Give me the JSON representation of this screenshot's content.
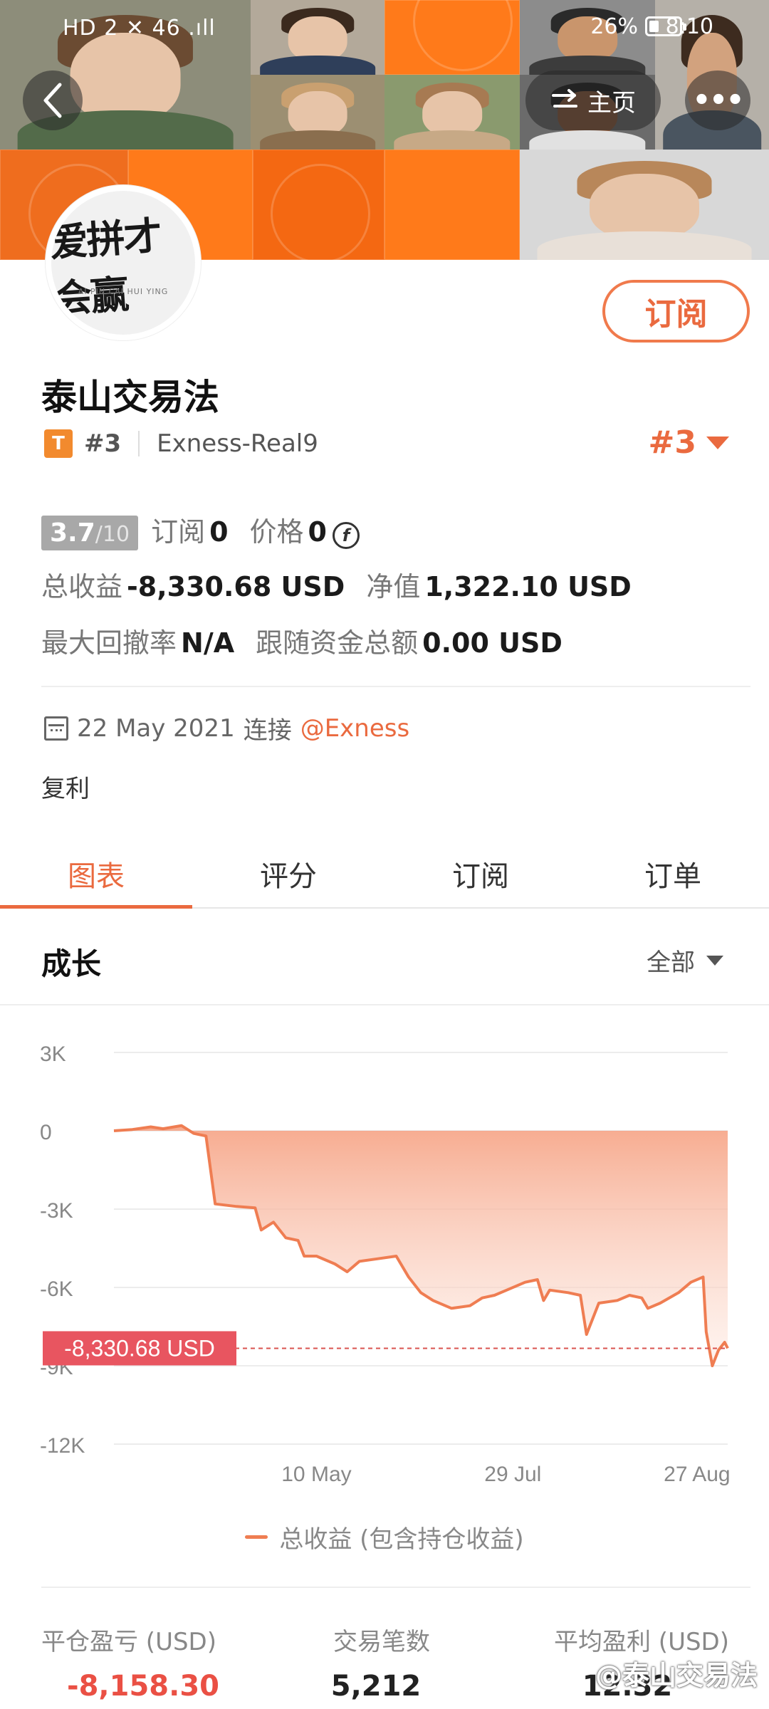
{
  "status_bar": {
    "left": "HD 2 ✕ 46 .ıll",
    "battery": "26%",
    "time": "8:10"
  },
  "header": {
    "home_label": "主页",
    "more_label": "•••"
  },
  "avatar": {
    "logo_text": "爱拼才会赢",
    "logo_sub": "AI PIN CAI HUI YING"
  },
  "subscribe_label": "订阅",
  "profile": {
    "name": "泰山交易法",
    "badge": "T",
    "rank": "#3",
    "broker": "Exness-Real9",
    "rank_right": "#3"
  },
  "stats": {
    "score_main": "3.7",
    "score_suffix": "/10",
    "subscribe_label": "订阅",
    "subscribe_value": "0",
    "price_label": "价格",
    "price_value": "0",
    "price_currency_symbol": "f",
    "total_profit_label": "总收益",
    "total_profit_value": "-8,330.68 USD",
    "equity_label": "净值",
    "equity_value": "1,322.10 USD",
    "max_drawdown_label": "最大回撤率",
    "max_drawdown_value": "N/A",
    "follow_funds_label": "跟随资金总额",
    "follow_funds_value": "0.00 USD"
  },
  "connection": {
    "date": "22 May 2021",
    "connect_label": "连接",
    "link": "@Exness"
  },
  "description": "复利",
  "tabs": [
    {
      "label": "图表",
      "active": true
    },
    {
      "label": "评分"
    },
    {
      "label": "订阅"
    },
    {
      "label": "订单"
    }
  ],
  "section": {
    "title": "成长",
    "filter": "全部"
  },
  "chart_data": {
    "type": "area",
    "y_ticks": [
      "3K",
      "0",
      "-3K",
      "-6K",
      "-9K",
      "-12K"
    ],
    "ylim": [
      -12000,
      3000
    ],
    "x_tick_labels": [
      "10 May",
      "29 Jul",
      "27 Aug"
    ],
    "x_tick_positions": [
      0.33,
      0.65,
      0.95
    ],
    "current_value_label": "-8,330.68 USD",
    "current_value": -8330.68,
    "series": [
      {
        "name": "总收益 (包含持仓收益)",
        "color": "#ef7d52",
        "points": [
          [
            0.0,
            0
          ],
          [
            0.03,
            50
          ],
          [
            0.06,
            150
          ],
          [
            0.08,
            80
          ],
          [
            0.11,
            200
          ],
          [
            0.13,
            -100
          ],
          [
            0.15,
            -200
          ],
          [
            0.165,
            -2800
          ],
          [
            0.2,
            -2900
          ],
          [
            0.23,
            -2950
          ],
          [
            0.24,
            -3800
          ],
          [
            0.26,
            -3500
          ],
          [
            0.28,
            -4100
          ],
          [
            0.3,
            -4200
          ],
          [
            0.31,
            -4800
          ],
          [
            0.33,
            -4800
          ],
          [
            0.36,
            -5100
          ],
          [
            0.38,
            -5400
          ],
          [
            0.4,
            -5000
          ],
          [
            0.43,
            -4900
          ],
          [
            0.46,
            -4800
          ],
          [
            0.48,
            -5600
          ],
          [
            0.5,
            -6200
          ],
          [
            0.52,
            -6500
          ],
          [
            0.55,
            -6800
          ],
          [
            0.58,
            -6700
          ],
          [
            0.6,
            -6400
          ],
          [
            0.62,
            -6300
          ],
          [
            0.64,
            -6100
          ],
          [
            0.67,
            -5800
          ],
          [
            0.69,
            -5700
          ],
          [
            0.7,
            -6500
          ],
          [
            0.71,
            -6100
          ],
          [
            0.74,
            -6200
          ],
          [
            0.76,
            -6300
          ],
          [
            0.77,
            -7800
          ],
          [
            0.79,
            -6600
          ],
          [
            0.82,
            -6500
          ],
          [
            0.84,
            -6300
          ],
          [
            0.86,
            -6400
          ],
          [
            0.87,
            -6800
          ],
          [
            0.89,
            -6600
          ],
          [
            0.92,
            -6200
          ],
          [
            0.94,
            -5800
          ],
          [
            0.96,
            -5600
          ],
          [
            0.965,
            -7700
          ],
          [
            0.975,
            -9000
          ],
          [
            0.985,
            -8400
          ],
          [
            0.995,
            -8100
          ],
          [
            1.0,
            -8330
          ]
        ]
      }
    ]
  },
  "legend_label": "总收益 (包含持仓收益)",
  "summary": [
    {
      "label": "平仓盈亏 (USD)",
      "value": "-8,158.30",
      "negative": true
    },
    {
      "label": "交易笔数",
      "value": "5,212"
    },
    {
      "label": "平均盈利 (USD)",
      "value": "12.32"
    }
  ],
  "watermark": "@泰山交易法",
  "colors": {
    "accent": "#ea6a3f",
    "banner": "#ff6a0c",
    "negative": "#ea5044"
  }
}
